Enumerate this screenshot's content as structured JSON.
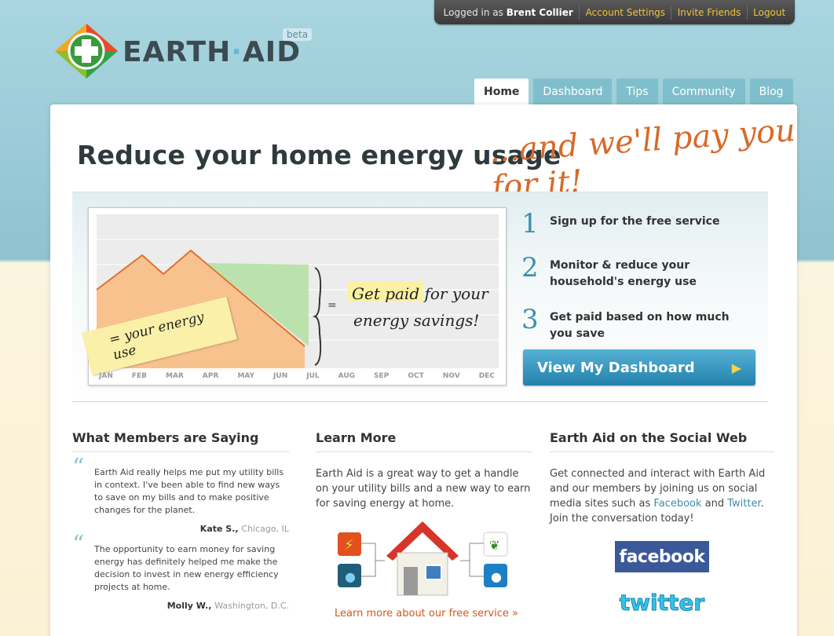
{
  "topbar": {
    "logged_in_prefix": "Logged in as",
    "user_name": "Brent Collier",
    "account_settings": "Account Settings",
    "invite_friends": "Invite Friends",
    "logout": "Logout"
  },
  "logo": {
    "name_left": "EARTH",
    "name_right": "AID",
    "badge": "beta"
  },
  "nav": {
    "tabs": [
      "Home",
      "Dashboard",
      "Tips",
      "Community",
      "Blog"
    ],
    "active": "Home"
  },
  "hero": {
    "headline": "Reduce your home energy usage",
    "tagline": "...and we'll pay you for it!",
    "graph_note_left": "= your energy use",
    "graph_note_right_1": "Get paid for your",
    "graph_note_right_2": "energy savings!",
    "months": [
      "JAN",
      "FEB",
      "MAR",
      "APR",
      "MAY",
      "JUN",
      "JUL",
      "AUG",
      "SEP",
      "OCT",
      "NOV",
      "DEC"
    ],
    "steps": [
      {
        "num": "1",
        "text": "Sign up for the free service"
      },
      {
        "num": "2",
        "text": "Monitor & reduce your household's energy use"
      },
      {
        "num": "3",
        "text": "Get paid based on how much you save"
      }
    ],
    "cta": "View My Dashboard"
  },
  "members": {
    "title": "What Members are Saying",
    "quotes": [
      {
        "text": "Earth Aid really helps me put my utility bills in context. I've been able to find new ways to save on my bills and to make positive changes for the planet.",
        "name": "Kate S.,",
        "location": "Chicago, IL"
      },
      {
        "text": "The opportunity to earn money for saving energy has definitely helped me make the decision to invest in new energy efficiency projects at home.",
        "name": "Molly W.,",
        "location": "Washington, D.C."
      }
    ]
  },
  "learn": {
    "title": "Learn More",
    "body": "Earth Aid is a great way to get a handle on your utility bills and a new way to earn for saving energy at home.",
    "link": "Learn more about our free service »"
  },
  "social": {
    "title": "Earth Aid on the Social Web",
    "body_1": "Get connected and interact with Earth Aid and our members by joining us on social media sites such as",
    "facebook_link": "Facebook",
    "and": "and",
    "twitter_link": "Twitter",
    "body_2": ". Join the conversation today!",
    "facebook_logo": "facebook",
    "twitter_logo": "twitter"
  },
  "colors": {
    "accent_orange": "#d76a2a",
    "cta_blue": "#2381ab",
    "tab_blue": "#7fbfcc"
  }
}
